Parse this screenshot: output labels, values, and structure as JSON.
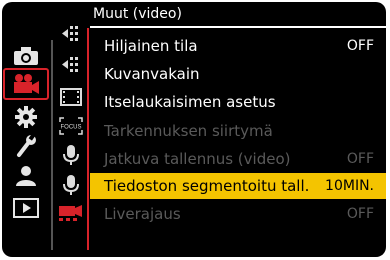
{
  "header": {
    "title": "Muut (video)"
  },
  "colors": {
    "accent": "#d8232a",
    "selection": "#f4c400",
    "disabled": "#5a5a5a"
  },
  "left_tabs": [
    {
      "icon": "camera-icon",
      "selected": false
    },
    {
      "icon": "video-camera-icon",
      "selected": true
    },
    {
      "icon": "gear-icon",
      "selected": false
    },
    {
      "icon": "wrench-icon",
      "selected": false
    },
    {
      "icon": "person-icon",
      "selected": false
    },
    {
      "icon": "playback-icon",
      "selected": false
    }
  ],
  "sub_tabs": [
    {
      "icon": "arrow-grid-icon"
    },
    {
      "icon": "arrow-grid-icon"
    },
    {
      "icon": "film-strip-icon"
    },
    {
      "icon": "focus-icon",
      "label": "FOCUS"
    },
    {
      "icon": "microphone-icon"
    },
    {
      "icon": "microphone-icon"
    },
    {
      "icon": "video-settings-icon",
      "selected": true
    }
  ],
  "menu": {
    "items": [
      {
        "label": "Hiljainen tila",
        "value": "OFF",
        "enabled": true,
        "selected": false
      },
      {
        "label": "Kuvanvakain",
        "value": "",
        "enabled": true,
        "selected": false
      },
      {
        "label": "Itselaukaisimen asetus",
        "value": "",
        "enabled": true,
        "selected": false
      },
      {
        "label": "Tarkennuksen siirtymä",
        "value": "",
        "enabled": false,
        "selected": false
      },
      {
        "label": "Jatkuva tallennus (video)",
        "value": "OFF",
        "enabled": false,
        "selected": false
      },
      {
        "label": "Tiedoston segmentoitu tall.",
        "value": "10MIN.",
        "enabled": true,
        "selected": true
      },
      {
        "label": "Liverajaus",
        "value": "OFF",
        "enabled": false,
        "selected": false
      }
    ]
  }
}
